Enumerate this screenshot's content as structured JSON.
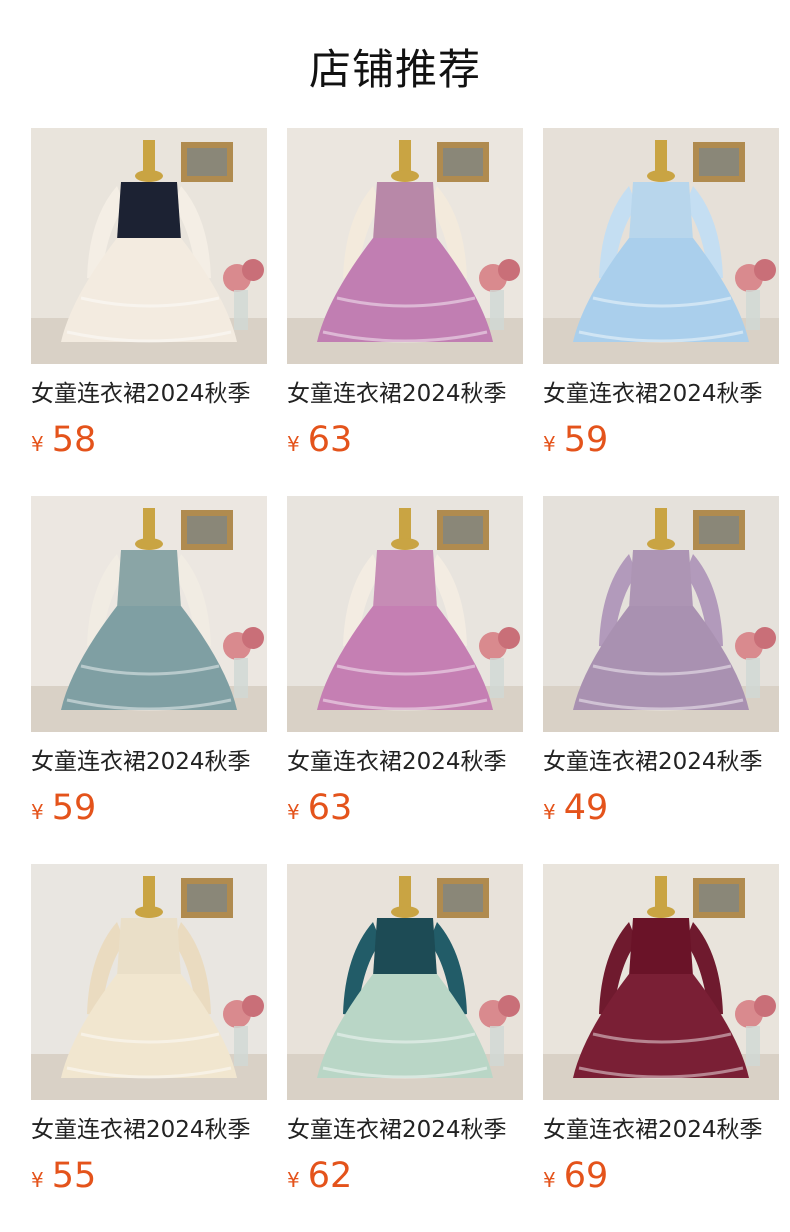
{
  "page": {
    "title": "店铺推荐"
  },
  "products": [
    {
      "title": "女童连衣裙2024秋季",
      "currency": "¥",
      "price": "58",
      "image_alt": "black sequin bodice tulle dress on mannequin",
      "colors": {
        "bg": "#e9e4dc",
        "bodice": "#1c2233",
        "skirt": "#f3ebe0",
        "sleeve": "#f4eee5"
      }
    },
    {
      "title": "女童连衣裙2024秋季",
      "currency": "¥",
      "price": "63",
      "image_alt": "pink ruffled tulle dress on mannequin",
      "colors": {
        "bg": "#ebe6df",
        "bodice": "#b888a8",
        "skirt": "#c17eb2",
        "sleeve": "#f3eadc"
      }
    },
    {
      "title": "女童连衣裙2024秋季",
      "currency": "¥",
      "price": "59",
      "image_alt": "light blue tulle dress with bow",
      "colors": {
        "bg": "#e6e0d8",
        "bodice": "#b8d6ec",
        "skirt": "#aacfec",
        "sleeve": "#c4def2"
      }
    },
    {
      "title": "女童连衣裙2024秋季",
      "currency": "¥",
      "price": "59",
      "image_alt": "girl wearing teal tulle dress sitting on floor",
      "colors": {
        "bg": "#ece7e1",
        "bodice": "#8aa5a6",
        "skirt": "#7f9fa3",
        "sleeve": "#f1ece3"
      }
    },
    {
      "title": "女童连衣裙2024秋季",
      "currency": "¥",
      "price": "63",
      "image_alt": "girl wearing pink ruffled dress on bench",
      "colors": {
        "bg": "#e8e4de",
        "bodice": "#c68cb5",
        "skirt": "#c57fb3",
        "sleeve": "#f3ece2"
      }
    },
    {
      "title": "女童连衣裙2024秋季",
      "currency": "¥",
      "price": "49",
      "image_alt": "lavender velvet dress with collar on hanger",
      "colors": {
        "bg": "#e5e1db",
        "bodice": "#ad95b4",
        "skirt": "#a991b1",
        "sleeve": "#b29abb"
      }
    },
    {
      "title": "女童连衣裙2024秋季",
      "currency": "¥",
      "price": "55",
      "image_alt": "girl wearing cream ruffle dress standing",
      "colors": {
        "bg": "#e9e6e1",
        "bodice": "#eadfc8",
        "skirt": "#f1e6cf",
        "sleeve": "#eadbc0"
      }
    },
    {
      "title": "女童连衣裙2024秋季",
      "currency": "¥",
      "price": "62",
      "image_alt": "teal velvet and mint tulle dress on mannequin",
      "colors": {
        "bg": "#e8e2da",
        "bodice": "#1d4b55",
        "skirt": "#b9d6c6",
        "sleeve": "#225c68"
      }
    },
    {
      "title": "女童连衣裙2024秋季",
      "currency": "¥",
      "price": "69",
      "image_alt": "burgundy velvet tulle dress on mannequin",
      "colors": {
        "bg": "#e9e4dc",
        "bodice": "#6a1328",
        "skirt": "#7a1f35",
        "sleeve": "#6f1a2e"
      }
    }
  ]
}
